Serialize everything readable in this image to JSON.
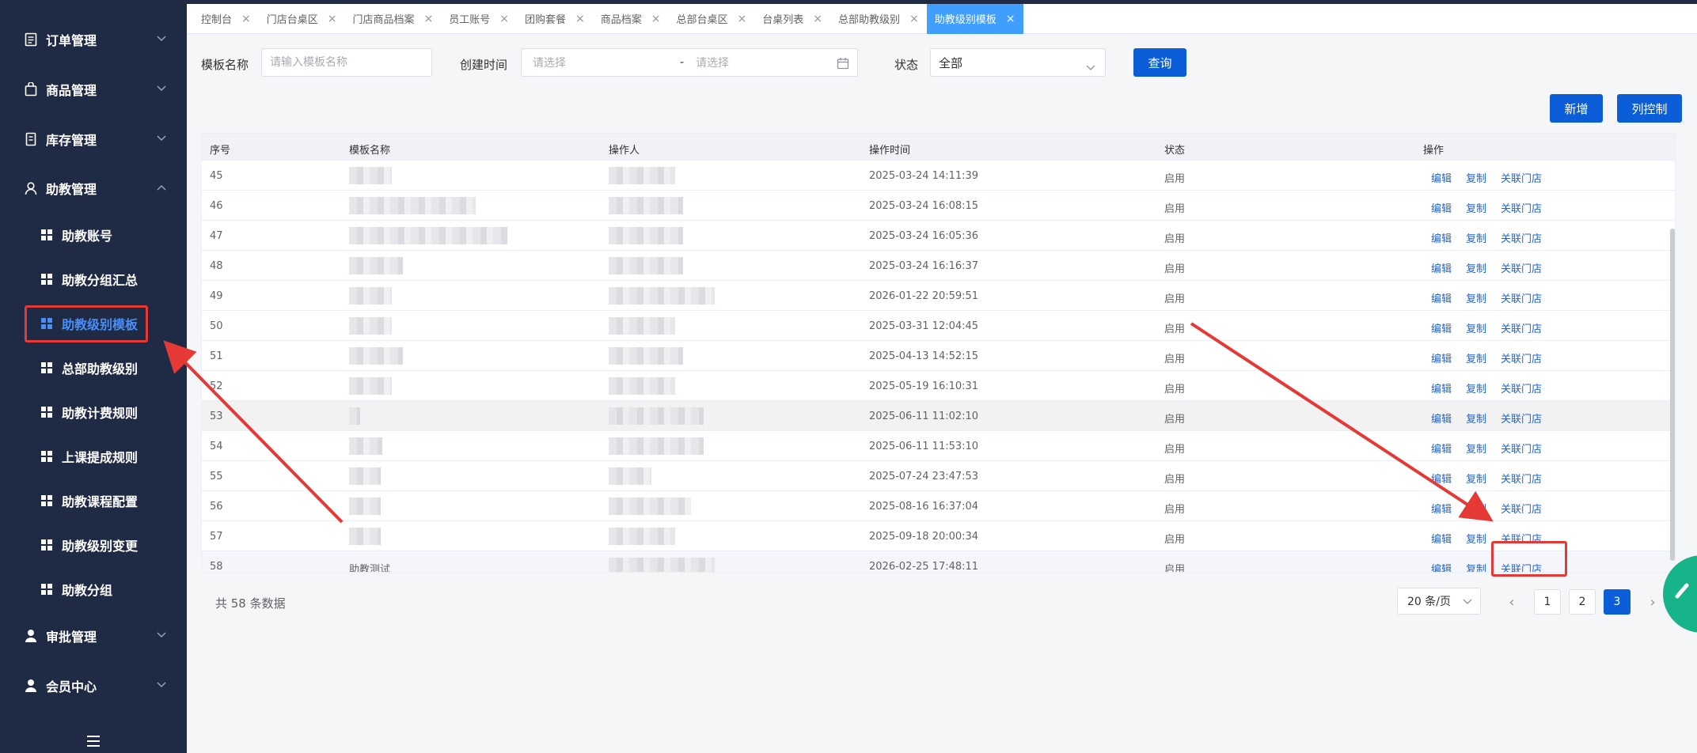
{
  "sidebar": {
    "groups": [
      {
        "label": "订单管理",
        "icon": "document-icon"
      },
      {
        "label": "商品管理",
        "icon": "bag-icon"
      },
      {
        "label": "库存管理",
        "icon": "inventory-icon"
      },
      {
        "label": "助教管理",
        "icon": "user-icon"
      }
    ],
    "subitems": [
      "助教账号",
      "助教分组汇总",
      "助教级别模板",
      "总部助教级别",
      "助教计费规则",
      "上课提成规则",
      "助教课程配置",
      "助教级别变更",
      "助教分组"
    ],
    "active_sub": "助教级别模板",
    "bottom_groups": [
      {
        "label": "审批管理",
        "icon": "person-icon"
      },
      {
        "label": "会员中心",
        "icon": "person-icon"
      }
    ]
  },
  "tabs": [
    {
      "label": "控制台"
    },
    {
      "label": "门店台桌区"
    },
    {
      "label": "门店商品档案"
    },
    {
      "label": "员工账号"
    },
    {
      "label": "团购套餐"
    },
    {
      "label": "商品档案"
    },
    {
      "label": "总部台桌区"
    },
    {
      "label": "台桌列表"
    },
    {
      "label": "总部助教级别"
    },
    {
      "label": "助教级别模板",
      "active": true
    }
  ],
  "filter": {
    "name_label": "模板名称",
    "name_placeholder": "请输入模板名称",
    "date_label": "创建时间",
    "date_start_placeholder": "请选择",
    "date_sep": "-",
    "date_end_placeholder": "请选择",
    "status_label": "状态",
    "status_value": "全部",
    "query_label": "查询"
  },
  "actions": {
    "add_label": "新增",
    "columns_label": "列控制"
  },
  "table": {
    "headers": [
      "序号",
      "模板名称",
      "操作人",
      "操作时间",
      "状态",
      "操作"
    ],
    "rows": [
      {
        "no": "45",
        "name": "",
        "time": "2025-03-24 14:11:39",
        "status": "启用"
      },
      {
        "no": "46",
        "name": "",
        "time": "2025-03-24 16:08:15",
        "status": "启用"
      },
      {
        "no": "47",
        "name": "",
        "time": "2025-03-24 16:05:36",
        "status": "启用"
      },
      {
        "no": "48",
        "name": "",
        "time": "2025-03-24 16:16:37",
        "status": "启用"
      },
      {
        "no": "49",
        "name": "",
        "time": "2026-01-22 20:59:51",
        "status": "启用"
      },
      {
        "no": "50",
        "name": "",
        "time": "2025-03-31 12:04:45",
        "status": "启用"
      },
      {
        "no": "51",
        "name": "",
        "time": "2025-04-13 14:52:15",
        "status": "启用"
      },
      {
        "no": "52",
        "name": "",
        "time": "2025-05-19 16:10:31",
        "status": "启用"
      },
      {
        "no": "53",
        "name": "",
        "time": "2025-06-11 11:02:10",
        "status": "启用"
      },
      {
        "no": "54",
        "name": "",
        "time": "2025-06-11 11:53:10",
        "status": "启用"
      },
      {
        "no": "55",
        "name": "",
        "time": "2025-07-24 23:47:53",
        "status": "启用"
      },
      {
        "no": "56",
        "name": "",
        "time": "2025-08-16 16:37:04",
        "status": "启用"
      },
      {
        "no": "57",
        "name": "",
        "time": "2025-09-18 20:00:34",
        "status": "启用"
      },
      {
        "no": "58",
        "name": "助教测试",
        "time": "2026-02-25 17:48:11",
        "status": "启用"
      }
    ],
    "op_labels": {
      "edit": "编辑",
      "copy": "复制",
      "link": "关联门店"
    }
  },
  "pagination": {
    "total_text": "共 58 条数据",
    "page_size": "20 条/页",
    "pages": [
      "1",
      "2",
      "3"
    ],
    "current": "3"
  },
  "colors": {
    "sidebar_bg": "#1f2a44",
    "primary": "#0b5ed7",
    "link": "#1f64d6",
    "active_tab": "#409eff",
    "annotation": "#e53935",
    "fab": "#17b48b"
  }
}
